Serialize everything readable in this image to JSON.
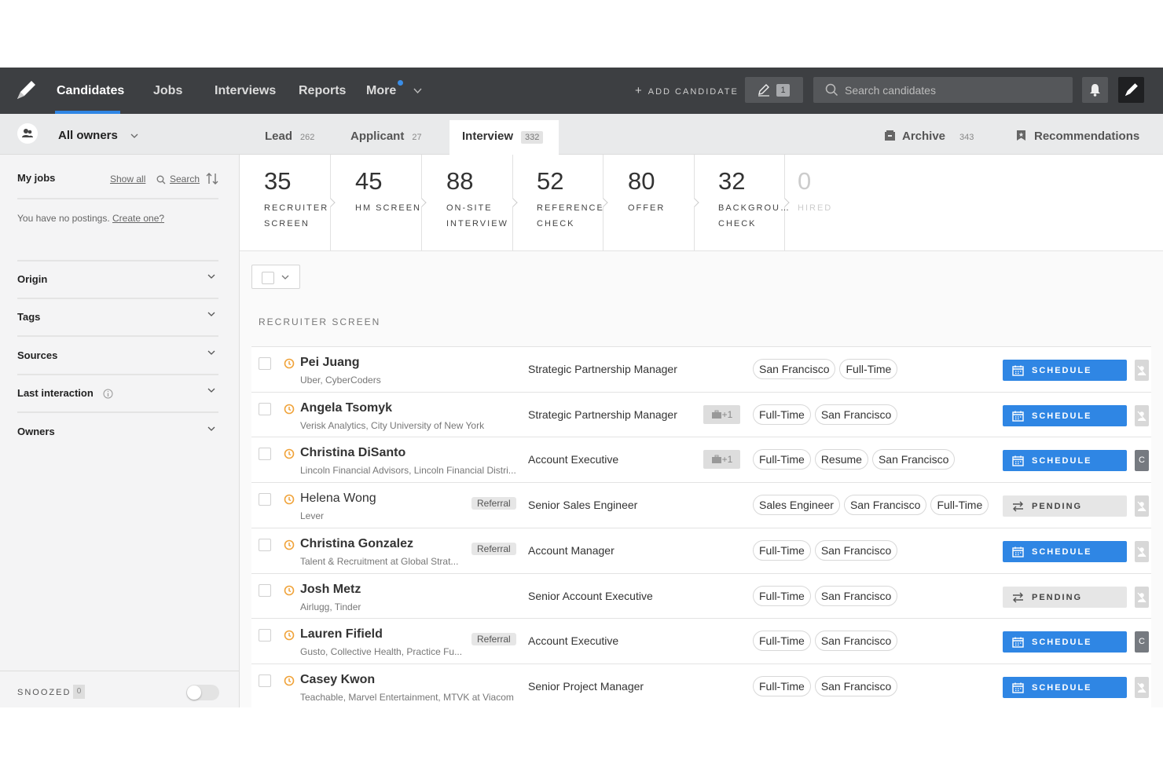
{
  "nav": {
    "items": [
      "Candidates",
      "Jobs",
      "Interviews",
      "Reports",
      "More"
    ],
    "add_candidate": "ADD CANDIDATE",
    "drafts_count": "1",
    "search_placeholder": "Search candidates"
  },
  "subbar": {
    "owners": "All owners",
    "tabs": [
      {
        "label": "Lead",
        "count": "262"
      },
      {
        "label": "Applicant",
        "count": "27"
      },
      {
        "label": "Interview",
        "count": "332"
      }
    ],
    "archive": {
      "label": "Archive",
      "count": "343"
    },
    "recommendations": "Recommendations"
  },
  "sidebar": {
    "my_jobs": "My jobs",
    "show_all": "Show all",
    "search": "Search",
    "no_postings": "You have no postings.",
    "create_one": "Create one?",
    "filters": [
      "Origin",
      "Tags",
      "Sources",
      "Last interaction",
      "Owners"
    ],
    "snoozed_label": "SNOOZED",
    "snoozed_count": "0"
  },
  "stages": [
    {
      "count": "35",
      "name": "RECRUITER SCREEN"
    },
    {
      "count": "45",
      "name": "HM SCREEN"
    },
    {
      "count": "88",
      "name": "ON-SITE INTERVIEW"
    },
    {
      "count": "52",
      "name": "REFERENCE CHECK"
    },
    {
      "count": "80",
      "name": "OFFER"
    },
    {
      "count": "32",
      "name": "BACKGROU… CHECK"
    },
    {
      "count": "0",
      "name": "HIRED"
    }
  ],
  "section_title": "RECRUITER SCREEN",
  "candidates": [
    {
      "name": "Pei Juang",
      "sub": "Uber, CyberCoders",
      "position": "Strategic Partnership Manager",
      "tags": [
        "San Francisco",
        "Full-Time"
      ],
      "action": "SCHEDULE"
    },
    {
      "name": "Angela Tsomyk",
      "sub": "Verisk Analytics, City University of New York",
      "position": "Strategic Partnership Manager",
      "jobs": "+1",
      "tags": [
        "Full-Time",
        "San Francisco"
      ],
      "action": "SCHEDULE"
    },
    {
      "name": "Christina DiSanto",
      "sub": "Lincoln Financial Advisors, Lincoln Financial Distri...",
      "position": "Account Executive",
      "jobs": "+1",
      "tags": [
        "Full-Time",
        "Resume",
        "San Francisco"
      ],
      "action": "SCHEDULE",
      "side": "C"
    },
    {
      "name": "Helena Wong",
      "sub": "Lever",
      "referral": "Referral",
      "position": "Senior Sales Engineer",
      "tags": [
        "Sales Engineer",
        "San Francisco",
        "Full-Time"
      ],
      "action": "PENDING"
    },
    {
      "name": "Christina Gonzalez",
      "sub": "Talent & Recruitment at Global Strat...",
      "referral": "Referral",
      "position": "Account Manager",
      "tags": [
        "Full-Time",
        "San Francisco"
      ],
      "action": "SCHEDULE"
    },
    {
      "name": "Josh Metz",
      "sub": "Airlugg, Tinder",
      "position": "Senior Account Executive",
      "tags": [
        "Full-Time",
        "San Francisco"
      ],
      "action": "PENDING"
    },
    {
      "name": "Lauren Fifield",
      "sub": "Gusto, Collective Health, Practice Fu...",
      "referral": "Referral",
      "position": "Account Executive",
      "tags": [
        "Full-Time",
        "San Francisco"
      ],
      "action": "SCHEDULE",
      "side": "C"
    },
    {
      "name": "Casey Kwon",
      "sub": "Teachable, Marvel Entertainment, MTVK at Viacom ...",
      "position": "Senior Project Manager",
      "tags": [
        "Full-Time",
        "San Francisco"
      ],
      "action": "SCHEDULE"
    }
  ],
  "colors": {
    "nav_bg": "#3d3f42",
    "accent": "#2f86e4",
    "clock": "#f0a33a"
  }
}
